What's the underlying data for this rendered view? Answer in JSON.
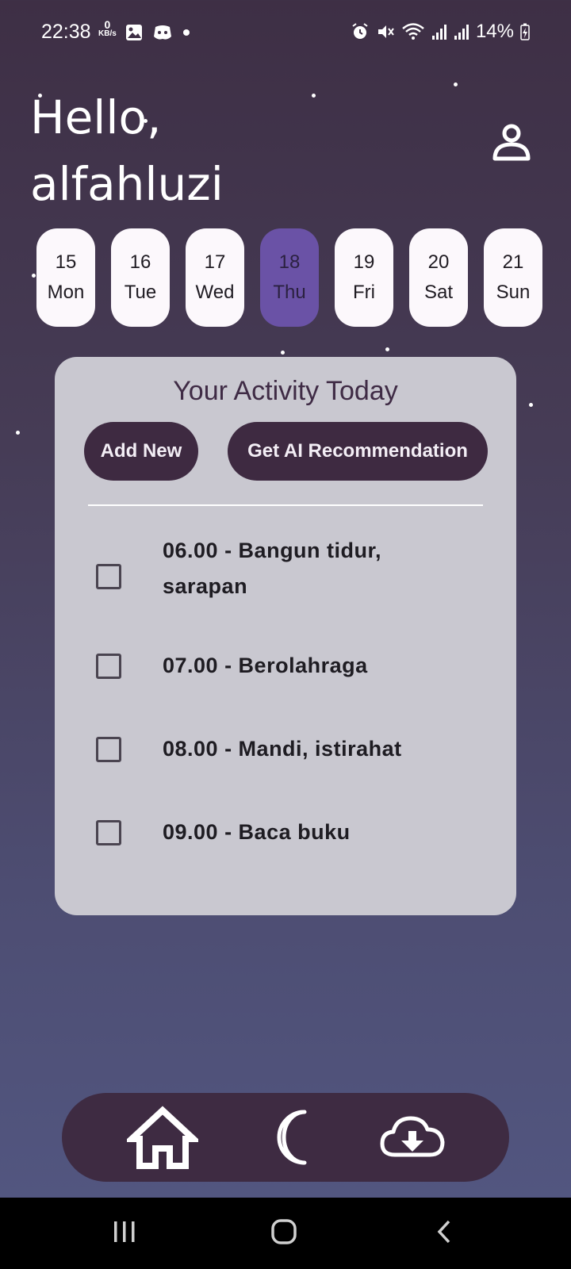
{
  "status_bar": {
    "time": "22:38",
    "net_speed_value": "0",
    "net_speed_unit": "KB/s",
    "battery": "14%",
    "icons": [
      "gallery-icon",
      "discord-icon",
      "dot-icon",
      "alarm-icon",
      "mute-icon",
      "wifi-icon",
      "signal-icon",
      "signal-icon",
      "battery-charging-icon"
    ]
  },
  "greeting": {
    "line1": "Hello,",
    "line2": "alfahluzi"
  },
  "dates": [
    {
      "day": "15",
      "weekday": "Mon",
      "selected": false
    },
    {
      "day": "16",
      "weekday": "Tue",
      "selected": false
    },
    {
      "day": "17",
      "weekday": "Wed",
      "selected": false
    },
    {
      "day": "18",
      "weekday": "Thu",
      "selected": true
    },
    {
      "day": "19",
      "weekday": "Fri",
      "selected": false
    },
    {
      "day": "20",
      "weekday": "Sat",
      "selected": false
    },
    {
      "day": "21",
      "weekday": "Sun",
      "selected": false
    }
  ],
  "activity": {
    "title": "Your Activity Today",
    "add_button": "Add New",
    "ai_button": "Get AI Recommendation",
    "tasks": [
      {
        "label": "06.00 - Bangun tidur, sarapan",
        "checked": false
      },
      {
        "label": "07.00 - Berolahraga",
        "checked": false
      },
      {
        "label": "08.00 - Mandi, istirahat",
        "checked": false
      },
      {
        "label": "09.00 - Baca buku",
        "checked": false
      }
    ]
  },
  "bottom_nav": {
    "items": [
      "home-icon",
      "moon-icon",
      "cloud-download-icon"
    ]
  },
  "colors": {
    "selected_date": "#6a52a6",
    "button_bg": "#3e2a41",
    "card_bg": "#c9c8d0"
  }
}
